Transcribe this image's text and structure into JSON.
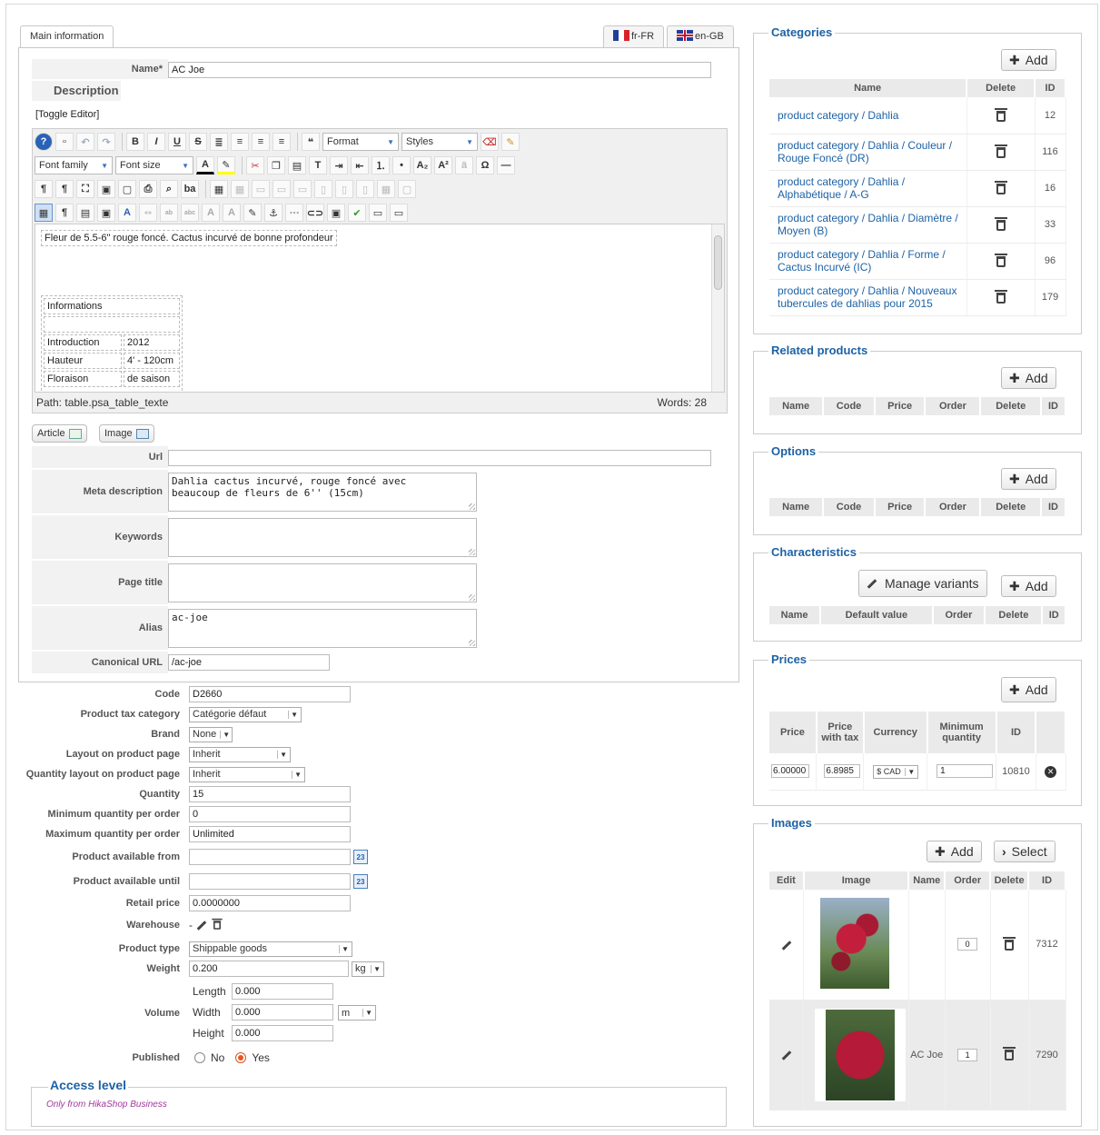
{
  "tabs": {
    "main": "Main information",
    "lang_fr": "fr-FR",
    "lang_en": "en-GB"
  },
  "form": {
    "name_label": "Name*",
    "name_value": "AC Joe",
    "description_label": "Description",
    "toggle_editor": "[Toggle Editor]",
    "url_label": "Url",
    "url_value": "",
    "meta_label": "Meta description",
    "meta_value": "Dahlia cactus incurvé, rouge foncé avec\nbeaucoup de fleurs de 6'' (15cm)",
    "keywords_label": "Keywords",
    "page_title_label": "Page title",
    "alias_label": "Alias",
    "alias_value": "ac-joe",
    "canonical_label": "Canonical URL",
    "canonical_value": "/ac-joe",
    "article_btn": "Article",
    "image_btn": "Image"
  },
  "editor": {
    "format_select": "Format",
    "styles_select": "Styles",
    "font_family_select": "Font family",
    "font_size_select": "Font size",
    "content_line": "Fleur de 5.5-6\" rouge foncé. Cactus incurvé de bonne profondeur",
    "table_title": "Informations",
    "rows": [
      {
        "k": "Introduction",
        "v": "2012"
      },
      {
        "k": "Hauteur",
        "v": "4' - 120cm"
      },
      {
        "k": "Floraison",
        "v": "de saison"
      }
    ],
    "path": "Path: table.psa_table_texte",
    "words": "Words: 28"
  },
  "attributes": {
    "code_label": "Code",
    "code_value": "D2660",
    "tax_label": "Product tax category",
    "tax_value": "Catégorie défaut",
    "brand_label": "Brand",
    "brand_value": "None",
    "layout_label": "Layout on product page",
    "layout_value": "Inherit",
    "qty_layout_label": "Quantity layout on product page",
    "qty_layout_value": "Inherit",
    "quantity_label": "Quantity",
    "quantity_value": "15",
    "min_qty_label": "Minimum quantity per order",
    "min_qty_value": "0",
    "max_qty_label": "Maximum quantity per order",
    "max_qty_value": "Unlimited",
    "avail_from_label": "Product available from",
    "avail_until_label": "Product available until",
    "calendar_text": "23",
    "retail_label": "Retail price",
    "retail_value": "0.0000000",
    "warehouse_label": "Warehouse",
    "warehouse_value": "-",
    "type_label": "Product type",
    "type_value": "Shippable goods",
    "weight_label": "Weight",
    "weight_value": "0.200",
    "weight_unit": "kg",
    "volume_label": "Volume",
    "length_label": "Length",
    "length_value": "0.000",
    "width_label": "Width",
    "width_value": "0.000",
    "height_label": "Height",
    "height_value": "0.000",
    "volume_unit": "m",
    "published_label": "Published",
    "no_label": "No",
    "yes_label": "Yes"
  },
  "access": {
    "title": "Access level",
    "note": "Only from HikaShop Business"
  },
  "categories": {
    "title": "Categories",
    "add": "Add",
    "headers": [
      "Name",
      "Delete",
      "ID"
    ],
    "rows": [
      {
        "path": "product category / Dahlia",
        "id": "12"
      },
      {
        "path": "product category / Dahlia / Couleur / Rouge Foncé (DR)",
        "id": "116"
      },
      {
        "path": "product category / Dahlia / Alphabétique / A-G",
        "id": "16"
      },
      {
        "path": "product category / Dahlia / Diamètre / Moyen (B)",
        "id": "33"
      },
      {
        "path": "product category / Dahlia / Forme / Cactus Incurvé (IC)",
        "id": "96"
      },
      {
        "path": "product category / Dahlia / Nouveaux tubercules de dahlias pour 2015",
        "id": "179"
      }
    ]
  },
  "related": {
    "title": "Related products",
    "add": "Add",
    "headers": [
      "Name",
      "Code",
      "Price",
      "Order",
      "Delete",
      "ID"
    ]
  },
  "options": {
    "title": "Options",
    "add": "Add",
    "headers": [
      "Name",
      "Code",
      "Price",
      "Order",
      "Delete",
      "ID"
    ]
  },
  "characteristics": {
    "title": "Characteristics",
    "manage": "Manage variants",
    "add": "Add",
    "headers": [
      "Name",
      "Default value",
      "Order",
      "Delete",
      "ID"
    ]
  },
  "prices": {
    "title": "Prices",
    "add": "Add",
    "headers": [
      "Price",
      "Price with tax",
      "Currency",
      "Minimum quantity",
      "ID"
    ],
    "row": {
      "price": "6.00000",
      "with_tax": "6.8985",
      "currency": "$ CAD",
      "min_qty": "1",
      "id": "10810"
    }
  },
  "images": {
    "title": "Images",
    "add": "Add",
    "select": "Select",
    "headers": [
      "Edit",
      "Image",
      "Name",
      "Order",
      "Delete",
      "ID"
    ],
    "rows": [
      {
        "name": "",
        "order": "0",
        "id": "7312"
      },
      {
        "name": "AC Joe",
        "order": "1",
        "id": "7290"
      }
    ]
  }
}
